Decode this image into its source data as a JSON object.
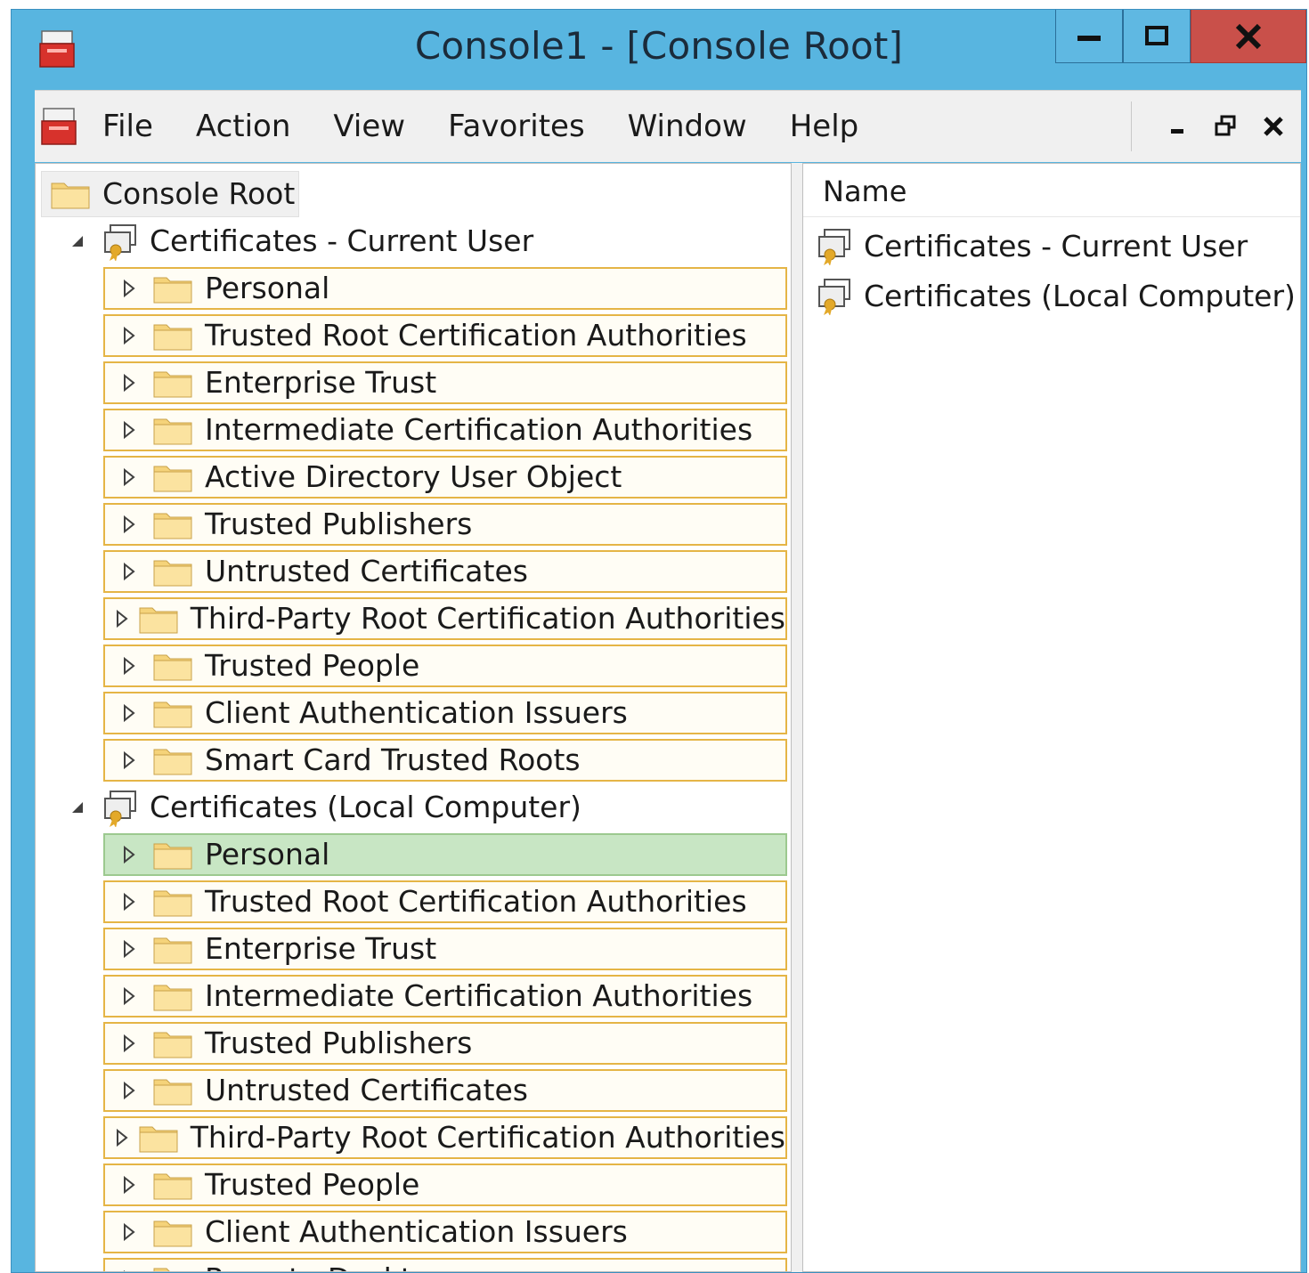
{
  "window": {
    "title": "Console1 - [Console Root]"
  },
  "menu": {
    "items": [
      "File",
      "Action",
      "View",
      "Favorites",
      "Window",
      "Help"
    ]
  },
  "tree": {
    "root_label": "Console Root",
    "groups": [
      {
        "label": "Certificates - Current User",
        "stores": [
          "Personal",
          "Trusted Root Certification Authorities",
          "Enterprise Trust",
          "Intermediate Certification Authorities",
          "Active Directory User Object",
          "Trusted Publishers",
          "Untrusted Certificates",
          "Third-Party Root Certification Authorities",
          "Trusted People",
          "Client Authentication Issuers",
          "Smart Card Trusted Roots"
        ]
      },
      {
        "label": "Certificates (Local Computer)",
        "stores": [
          "Personal",
          "Trusted Root Certification Authorities",
          "Enterprise Trust",
          "Intermediate Certification Authorities",
          "Trusted Publishers",
          "Untrusted Certificates",
          "Third-Party Root Certification Authorities",
          "Trusted People",
          "Client Authentication Issuers",
          "Remote Desktop"
        ],
        "selected_store": "Personal"
      }
    ]
  },
  "list": {
    "column_header": "Name",
    "items": [
      "Certificates - Current User",
      "Certificates (Local Computer)"
    ]
  },
  "colors": {
    "titlebar": "#58b5e0",
    "close_button": "#c9504a",
    "store_border": "#e5b546",
    "selected_row": "#c8e6c4"
  }
}
